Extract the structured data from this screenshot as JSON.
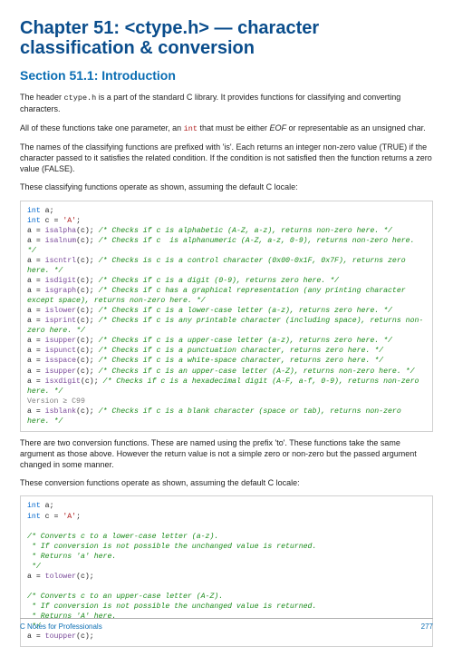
{
  "chapter": "Chapter 51: <ctype.h> — character classification & conversion",
  "section": "Section 51.1: Introduction",
  "p1a": "The header ",
  "p1code": "ctype.h",
  "p1b": " is a part of the standard C library. It provides functions for classifying and converting characters.",
  "p2a": "All of these functions take one parameter, an ",
  "p2int": "int",
  "p2b": " that must be either ",
  "p2eof": "EOF",
  "p2c": " or representable as an unsigned char.",
  "p3": "The names of the classifying functions are prefixed with 'is'. Each returns an integer non-zero value (TRUE) if the character passed to it satisfies the related condition. If the condition is not satisfied then the function returns a zero value (FALSE).",
  "p4": "These classifying functions operate as shown, assuming the default C locale:",
  "code1": {
    "l1a": "int",
    "l1b": " a;",
    "l2a": "int",
    "l2b": " c = ",
    "l2c": "'A'",
    "l2d": ";",
    "r1f": "isalpha",
    "r1c": "/* Checks if c is alphabetic (A-Z, a-z), returns non-zero here. */",
    "r2f": "isalnum",
    "r2c": "/* Checks if c  is alphanumeric (A-Z, a-z, 0-9), returns non-zero here. */",
    "r3f": "iscntrl",
    "r3c": "/* Checks is c is a control character (0x00-0x1F, 0x7F), returns zero here. */",
    "r4f": "isdigit",
    "r4c": "/* Checks if c is a digit (0-9), returns zero here. */",
    "r5f": "isgraph",
    "r5c": "/* Checks if c has a graphical representation (any printing character except space), returns non-zero here. */",
    "r6f": "islower",
    "r6c": "/* Checks if c is a lower-case letter (a-z), returns zero here. */",
    "r7f": "isprint",
    "r7c": "/* Checks if c is any printable character (including space), returns non-zero here. */",
    "r8f": "isupper",
    "r8c": "/* Checks if c is a upper-case letter (a-z), returns zero here. */",
    "r9f": "ispunct",
    "r9c": "/* Checks if c is a punctuation character, returns zero here. */",
    "r10f": "isspace",
    "r10c": "/* Checks if c is a white-space character, returns zero here. */",
    "r11f": "isupper",
    "r11c": "/* Checks if c is an upper-case letter (A-Z), returns non-zero here. */",
    "r12f": "isxdigit",
    "r12c": "/* Checks if c is a hexadecimal digit (A-F, a-f, 0-9), returns non-zero here. */",
    "ver": "Version ≥ C99",
    "r13f": "isblank",
    "r13c": "/* Checks if c is a blank character (space or tab), returns non-zero here. */"
  },
  "p5": "There are two conversion functions. These are named using the prefix 'to'. These functions take the same argument as those above. However the return value is not a simple zero or non-zero but the passed argument changed in some manner.",
  "p6": "These conversion functions operate as shown, assuming the default C locale:",
  "code2": {
    "l1a": "int",
    "l1b": " a;",
    "l2a": "int",
    "l2b": " c = ",
    "l2c": "'A'",
    "l2d": ";",
    "c1a": "/* Converts c to a lower-case letter (a-z).",
    "c1b": " * If conversion is not possible the unchanged value is returned.",
    "c1c": " * Returns 'a' here.",
    "c1d": " */",
    "f1": "tolower",
    "c2a": "/* Converts c to an upper-case letter (A-Z).",
    "c2b": " * If conversion is not possible the unchanged value is returned.",
    "c2c": " * Returns 'A' here.",
    "c2d": " */",
    "f2": "toupper"
  },
  "footer": {
    "left": "C Notes for Professionals",
    "right": "277"
  }
}
